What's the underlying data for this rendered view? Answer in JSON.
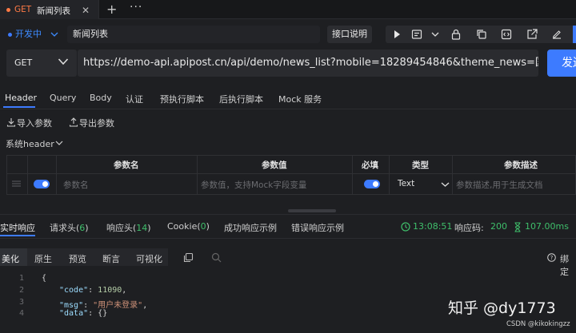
{
  "tab": {
    "method": "GET",
    "title": "新闻列表",
    "close": "✕",
    "add": "+",
    "more": "···"
  },
  "env": {
    "label": "开发中"
  },
  "request": {
    "name": "新闻列表",
    "doc_button": "接口说明",
    "method": "GET",
    "url": "https://demo-api.apipost.cn/api/demo/news_list?mobile=18289454846&theme_news=国际",
    "send": "发送"
  },
  "request_tabs": [
    "Header",
    "Query",
    "Body",
    "认证",
    "预执行脚本",
    "后执行脚本",
    "Mock 服务"
  ],
  "params": {
    "import": "导入参数",
    "export": "导出参数",
    "system_header": "系统header"
  },
  "table": {
    "headers": {
      "name": "参数名",
      "value": "参数值",
      "required": "必填",
      "type": "类型",
      "desc": "参数描述"
    },
    "row": {
      "name_placeholder": "参数名",
      "value_placeholder": "参数值，支持Mock字段变量",
      "type": "Text",
      "desc_placeholder": "参数描述,用于生成文档"
    }
  },
  "response_tabs": {
    "realtime": "实时响应",
    "req_headers": "请求头(",
    "req_headers_count": "6",
    "resp_headers": "响应头(",
    "resp_headers_count": "14",
    "cookie": "Cookie(",
    "cookie_count": "0",
    "close_paren": ")",
    "success_example": "成功响应示例",
    "error_example": "错误响应示例"
  },
  "response_meta": {
    "time": "13:08:51",
    "status_label": "响应码:",
    "status": "200",
    "duration": "107.00ms"
  },
  "view_tabs": [
    "美化",
    "原生",
    "预览",
    "断言",
    "可视化"
  ],
  "bind_label": "绑定",
  "code": {
    "lines": [
      "1",
      "2",
      "3",
      "4"
    ],
    "open": "{",
    "k_code": "\"code\"",
    "v_code": "11090",
    "k_msg": "\"msg\"",
    "v_msg": "\"用户未登录\"",
    "k_data": "\"data\"",
    "v_data": "{}"
  },
  "watermark": "知乎 @dy1773",
  "credit": "CSDN @kikokingzz",
  "colors": {
    "accent": "#3d7bff",
    "method_orange": "#ff7a45",
    "success_green": "#3fbf6b",
    "background": "#1e1f22"
  }
}
